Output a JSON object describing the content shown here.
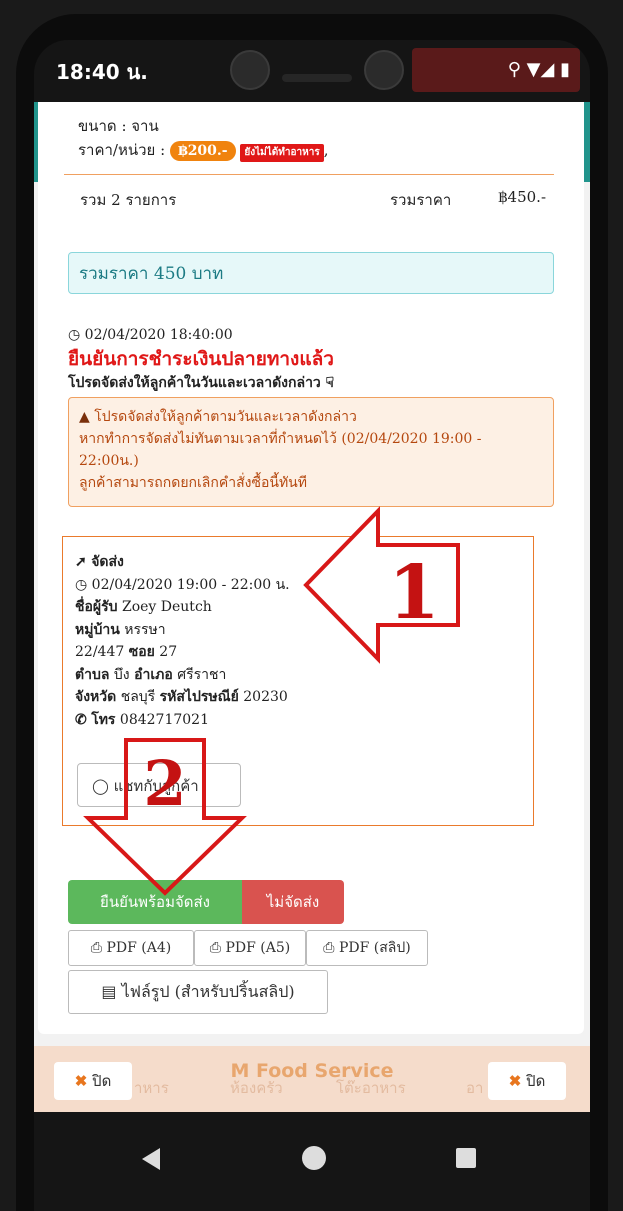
{
  "statusbar": {
    "time": "18:40 น.",
    "icons": "⚲ ▼◢ ▮"
  },
  "order_item": {
    "size_line": "ขนาด : จาน",
    "price_label": "ราคา/หน่วย :",
    "price_value": "฿200.-",
    "status_badge": "ยังไม่ได้ทำอาหาร",
    "trailing": ","
  },
  "summary": {
    "items_label": "รวม 2 รายการ",
    "total_label": "รวมราคา",
    "total_value": "฿450.-"
  },
  "total_box": "รวมราคา 450 บาท",
  "confirmation": {
    "timestamp": "02/04/2020 18:40:00",
    "title": "ยืนยันการชำระเงินปลายทางแล้ว",
    "instruction": "โปรดจัดส่งให้ลูกค้าในวันและเวลาดังกล่าว"
  },
  "warning": {
    "line1": "โปรดจัดส่งให้ลูกค้าตามวันและเวลาดังกล่าว",
    "line2": "หากทำการจัดส่งไม่ทันตามเวลาที่กำหนดไว้ (02/04/2020 19:00 - 22:00น.)",
    "line3": "ลูกค้าสามารถกดยกเลิกคำสั่งซื้อนี้ทันที"
  },
  "shipping": {
    "heading": "จัดส่ง",
    "time": "02/04/2020 19:00 - 22:00 น.",
    "recipient_label": "ชื่อผู้รับ",
    "recipient": "Zoey Deutch",
    "village_label": "หมู่บ้าน",
    "village": "หรรษา",
    "address": "22/447",
    "soi_label": "ซอย",
    "soi": "27",
    "subdistrict_label": "ตำบล",
    "subdistrict": "บึง",
    "district_label": "อำเภอ",
    "district": "ศรีราชา",
    "province_label": "จังหวัด",
    "province": "ชลบุรี",
    "postcode_label": "รหัสไปรษณีย์",
    "postcode": "20230",
    "phone_label": "โทร",
    "phone": "0842717021",
    "chat_button": "แชทกับลูกค้า"
  },
  "actions": {
    "confirm_ship": "ยืนยันพร้อมจัดส่ง",
    "no_ship": "ไม่จัดส่ง",
    "pdf_a4": "PDF (A4)",
    "pdf_a5": "PDF (A5)",
    "pdf_slip": "PDF (สลิป)",
    "image_file": "ไฟล์รูป (สำหรับปริ้นสลิป)"
  },
  "bottom": {
    "title": "M Food Service",
    "close_left": "ปิด",
    "close_right": "ปิด",
    "bg_tabs": [
      "าหาร",
      "ห้องครัว",
      "โต๊ะอาหาร",
      "อา"
    ]
  },
  "annotations": {
    "arrow1_number": "1",
    "arrow2_number": "2"
  },
  "colors": {
    "teal": "#21948c",
    "orange": "#f0830e",
    "red": "#e01818",
    "green": "#5cb85c",
    "danger": "#d9534f"
  }
}
